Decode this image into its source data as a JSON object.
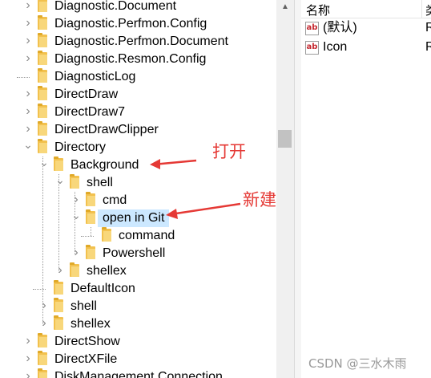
{
  "tree": {
    "items": [
      {
        "label": "Diagnostic.Document",
        "expanded": false
      },
      {
        "label": "Diagnostic.Perfmon.Config",
        "expanded": false
      },
      {
        "label": "Diagnostic.Perfmon.Document",
        "expanded": false
      },
      {
        "label": "Diagnostic.Resmon.Config",
        "expanded": false
      },
      {
        "label": "DiagnosticLog",
        "expanded": null
      },
      {
        "label": "DirectDraw",
        "expanded": false
      },
      {
        "label": "DirectDraw7",
        "expanded": false
      },
      {
        "label": "DirectDrawClipper",
        "expanded": false
      },
      {
        "label": "Directory",
        "expanded": true
      },
      {
        "label": "Background",
        "expanded": true
      },
      {
        "label": "shell",
        "expanded": true
      },
      {
        "label": "cmd",
        "expanded": false
      },
      {
        "label": "open in Git",
        "expanded": true,
        "selected": true
      },
      {
        "label": "command",
        "expanded": null
      },
      {
        "label": "Powershell",
        "expanded": false
      },
      {
        "label": "shellex",
        "expanded": false
      },
      {
        "label": "DefaultIcon",
        "expanded": null
      },
      {
        "label": "shell",
        "expanded": false
      },
      {
        "label": "shellex",
        "expanded": false
      },
      {
        "label": "DirectShow",
        "expanded": false
      },
      {
        "label": "DirectXFile",
        "expanded": false
      },
      {
        "label": "DiskManagement.Connection",
        "expanded": false
      }
    ]
  },
  "values_pane": {
    "header": {
      "name": "名称",
      "type": "类"
    },
    "rows": [
      {
        "name": "(默认)",
        "type": "R",
        "icon": "string-value-icon"
      },
      {
        "name": "Icon",
        "type": "R",
        "icon": "string-value-icon"
      }
    ]
  },
  "annotations": {
    "open_label": "打开",
    "new_label": "新建",
    "color": "#e53935"
  },
  "watermark": "CSDN @三水木雨",
  "colors": {
    "selection": "#cce8ff",
    "folder": "#f2c14e"
  }
}
